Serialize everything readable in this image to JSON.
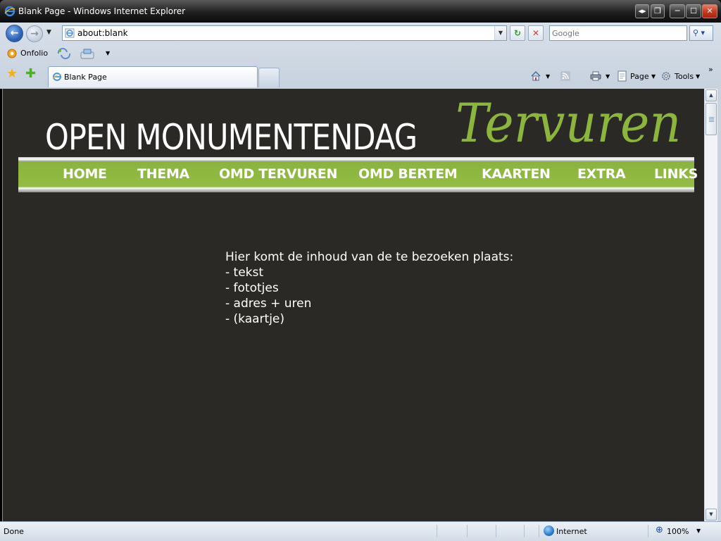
{
  "window": {
    "title": "Blank Page - Windows Internet Explorer",
    "restore_symbol": "◂▸",
    "switch_symbol": "❐",
    "minimize_symbol": "─",
    "maximize_symbol": "☐",
    "close_symbol": "✕"
  },
  "address_bar": {
    "url": "about:blank",
    "dropdown_symbol": "▼",
    "refresh_symbol": "↻",
    "stop_symbol": "✕"
  },
  "search": {
    "placeholder": "Google",
    "go_symbol": "⚲ ▾"
  },
  "links_bar": {
    "onfolio_label": "Onfolio"
  },
  "tab_bar": {
    "favorites_symbol": "★",
    "add_favorites_symbol": "✚",
    "active_tab_label": "Blank Page",
    "page_label": "Page",
    "tools_label": "Tools",
    "more_symbol": "»"
  },
  "site": {
    "title": "OPEN MONUMENTENDAG",
    "script_title": "Tervuren",
    "accent_color": "#8cb53d",
    "background_color": "#2b2925",
    "nav": [
      {
        "label": "HOME"
      },
      {
        "label": "THEMA"
      },
      {
        "label": "OMD TERVUREN"
      },
      {
        "label": "OMD BERTEM"
      },
      {
        "label": "KAARTEN"
      },
      {
        "label": "EXTRA"
      },
      {
        "label": "LINKS"
      }
    ],
    "content_lines": [
      "Hier komt de inhoud van de te bezoeken plaats:",
      "- tekst",
      "- fototjes",
      "- adres + uren",
      "- (kaartje)"
    ]
  },
  "statusbar": {
    "status": "Done",
    "zone": "Internet",
    "zoom": "100%"
  },
  "icons": {
    "app": "ie-logo-icon",
    "refresh": "refresh-icon",
    "stop": "stop-icon",
    "search": "magnifier-icon",
    "home": "home-icon",
    "feeds": "rss-icon",
    "print": "printer-icon",
    "page": "page-icon",
    "tools": "gear-icon",
    "zone": "globe-icon",
    "zoom": "zoom-icon"
  }
}
